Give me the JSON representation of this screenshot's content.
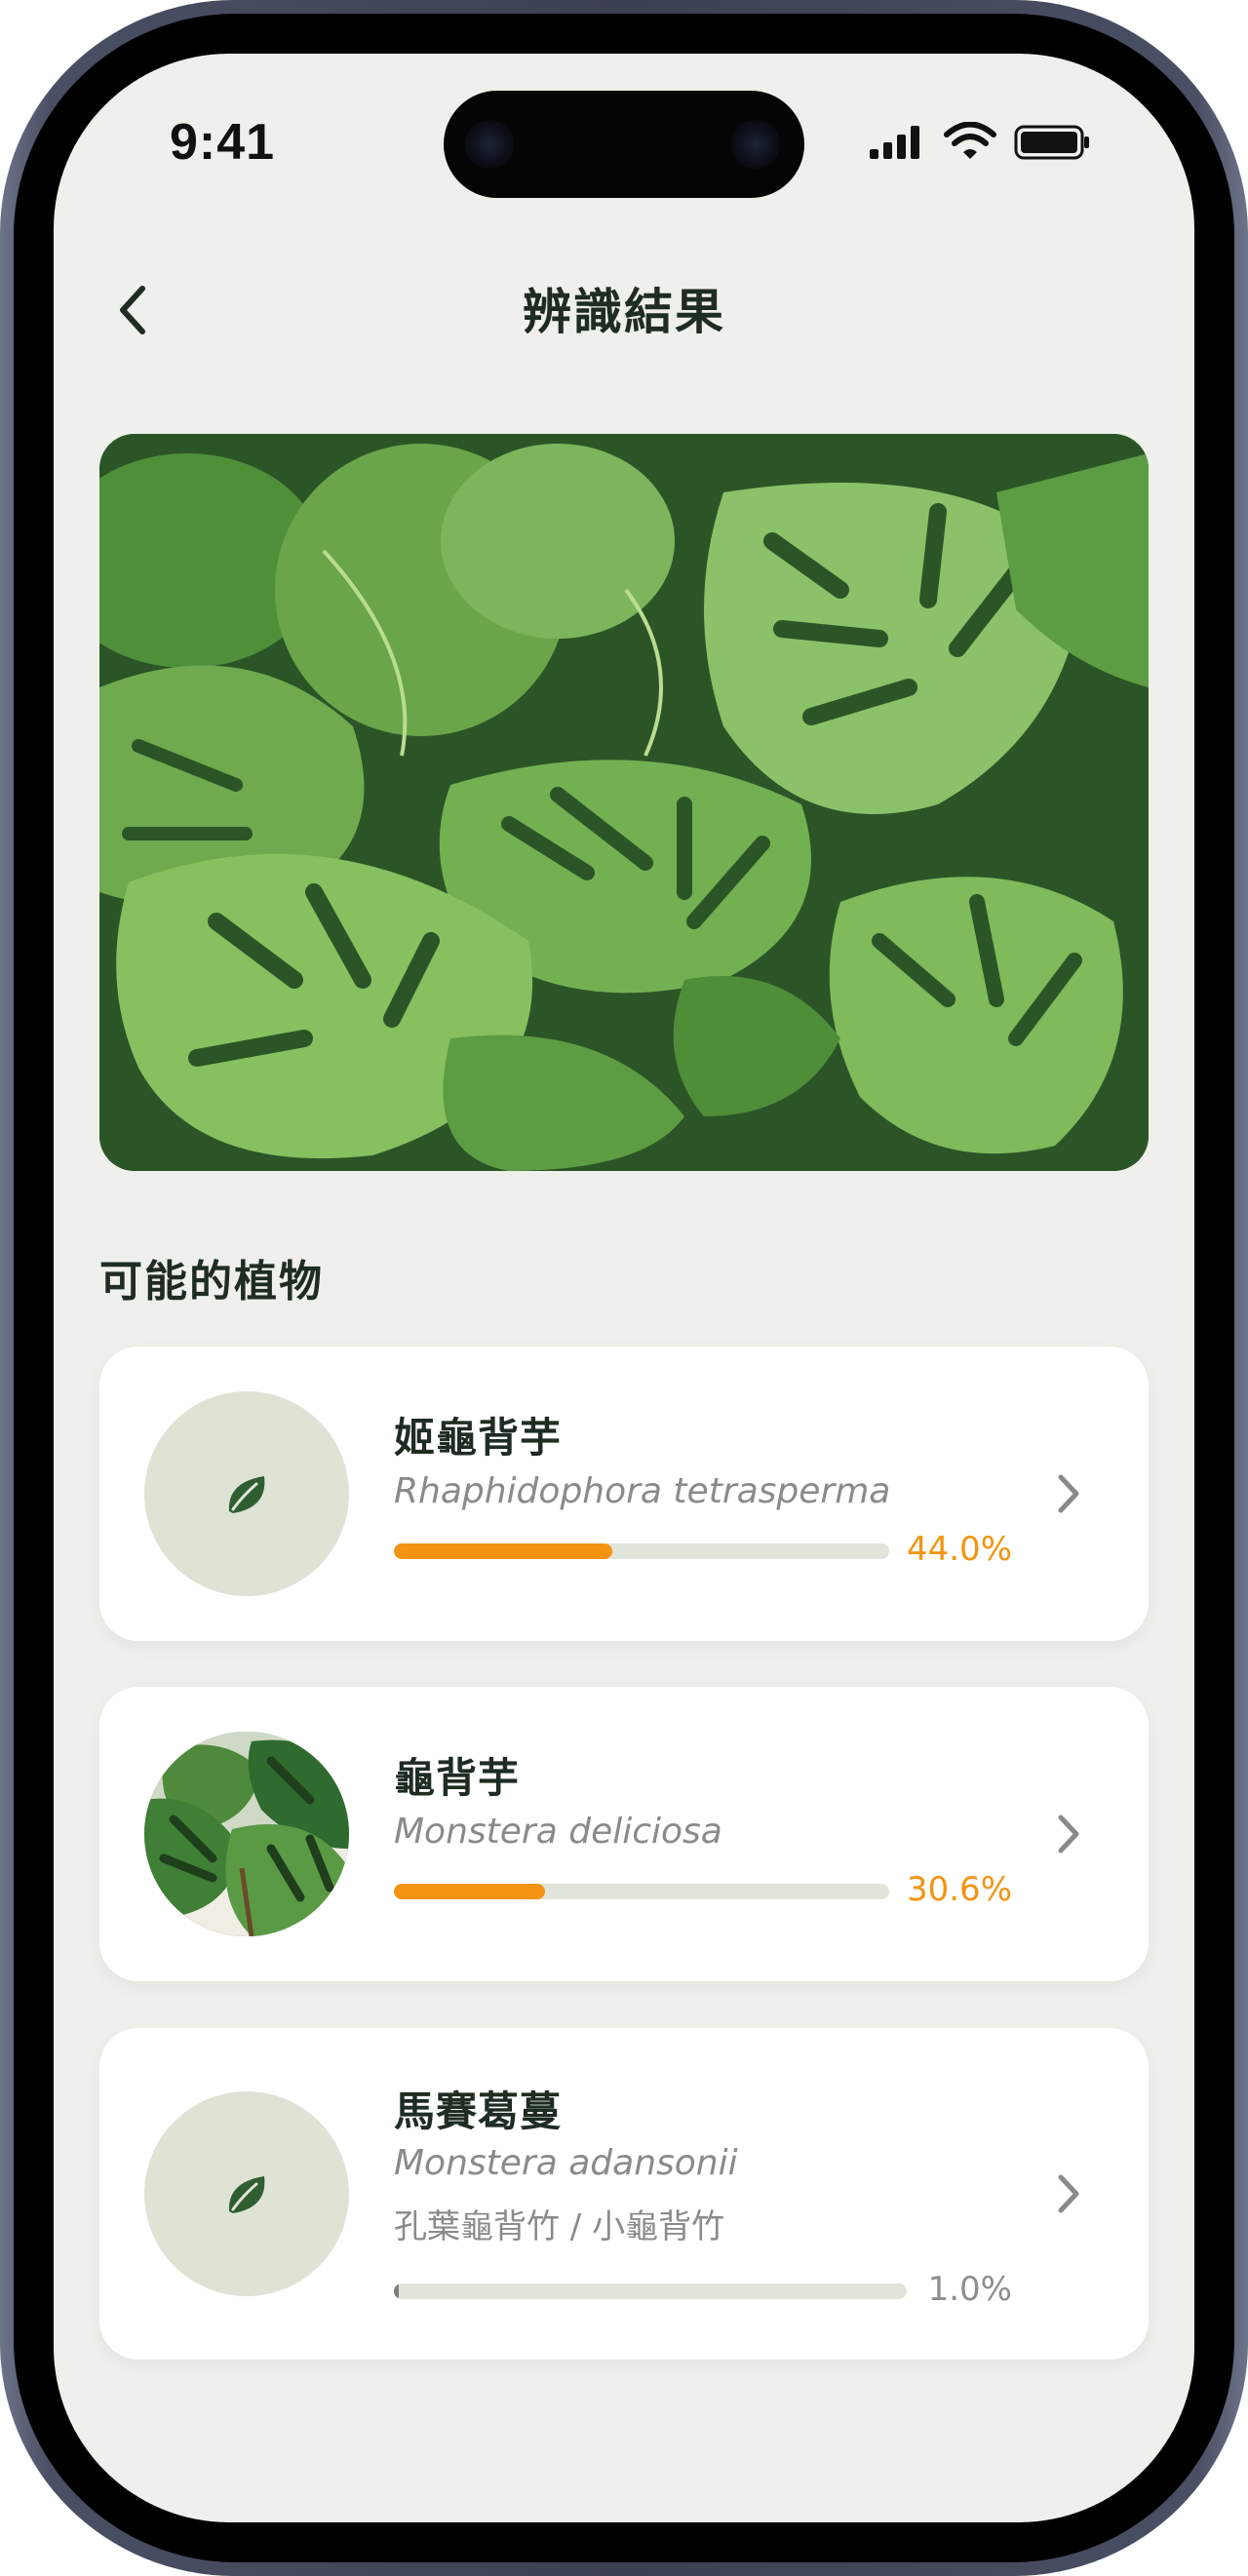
{
  "status_bar": {
    "time": "9:41",
    "icons": [
      "cellular-signal-icon",
      "wifi-icon",
      "battery-icon"
    ]
  },
  "header": {
    "back_icon": "chevron-left-icon",
    "title": "辨識結果"
  },
  "hero_image": {
    "subject": "photo of monstera leaves"
  },
  "section": {
    "title": "可能的植物"
  },
  "results": [
    {
      "name": "姬龜背芋",
      "scientific_name": "Rhaphidophora tetrasperma",
      "confidence_label": "44.0%",
      "confidence": 0.44,
      "thumbnail": "leaf-icon"
    },
    {
      "name": "龜背芋",
      "scientific_name": "Monstera deliciosa",
      "confidence_label": "30.6%",
      "confidence": 0.306,
      "thumbnail": "monstera-photo"
    },
    {
      "name": "馬賽葛蔓",
      "scientific_name": "Monstera adansonii",
      "alias": "孔葉龜背竹 / 小龜背竹",
      "confidence_label": "1.0%",
      "confidence": 0.01,
      "thumbnail": "leaf-icon"
    }
  ],
  "colors": {
    "background": "#eff0eb",
    "accent": "#f39312",
    "text_dark": "#1f2c22",
    "leaf_icon": "#2f5e30",
    "thumb_bg": "#dfe3d6"
  }
}
